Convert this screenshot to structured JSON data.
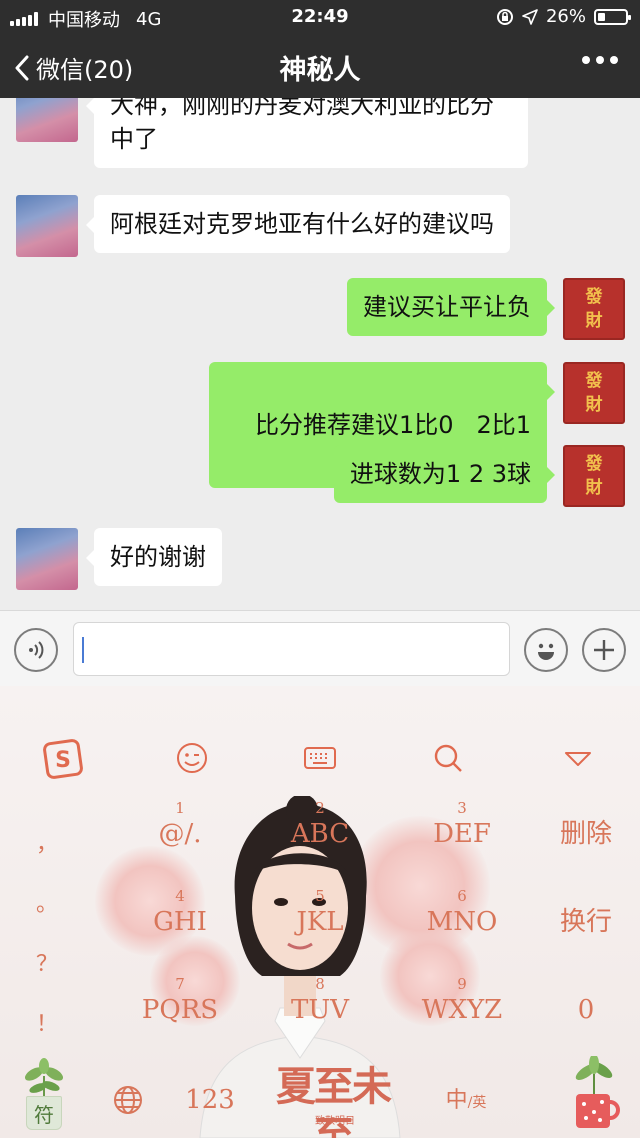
{
  "status_bar": {
    "carrier": "中国移动",
    "network": "4G",
    "time": "22:49",
    "battery": "26%",
    "battery_level": 0.26
  },
  "nav": {
    "back_label": "微信(20)",
    "title": "神秘人"
  },
  "messages": [
    {
      "side": "in",
      "text_line1": "大神，刚刚的丹麦对澳大利亚的比分",
      "text_line2": "中了"
    },
    {
      "side": "in",
      "text": "阿根廷对克罗地亚有什么好的建议吗"
    },
    {
      "side": "out",
      "text": "建议买让平让负"
    },
    {
      "side": "out",
      "text": "比分推荐建议1比0   2比1"
    },
    {
      "side": "out",
      "text": "进球数为1 2 3球"
    },
    {
      "side": "in",
      "text": "好的谢谢"
    }
  ],
  "self_avatar": {
    "top": "發",
    "bottom": "財"
  },
  "input": {
    "placeholder": ""
  },
  "keyboard": {
    "keys": [
      {
        "num": "1",
        "label": "@/."
      },
      {
        "num": "2",
        "label": "ABC"
      },
      {
        "num": "3",
        "label": "DEF"
      },
      {
        "num": "4",
        "label": "GHI"
      },
      {
        "num": "5",
        "label": "JKL"
      },
      {
        "num": "6",
        "label": "MNO"
      },
      {
        "num": "7",
        "label": "PQRS"
      },
      {
        "num": "8",
        "label": "TUV"
      },
      {
        "num": "9",
        "label": "WXYZ"
      }
    ],
    "delete_label": "删除",
    "newline_label": "换行",
    "zero_label": "0",
    "punct": [
      "，",
      "。",
      "？",
      "！"
    ],
    "symbol_label": "符",
    "num_label": "123",
    "lang_main": "中",
    "lang_alt": "/英",
    "brand_text": "夏至未至",
    "brand_sub": "致敬明日"
  },
  "colors": {
    "nav_bg": "#2e2e2e",
    "bubble_out": "#95ec69",
    "bubble_in": "#ffffff",
    "keyboard_accent": "#d8765a"
  },
  "icons": [
    "signal-icon",
    "location-arrow-icon",
    "orientation-lock-icon",
    "battery-icon",
    "back-chevron-icon",
    "more-icon",
    "voice-icon",
    "emoji-icon",
    "plus-icon",
    "sogou-logo-icon",
    "keyboard-emoji-icon",
    "keyboard-toggle-icon",
    "search-icon",
    "collapse-icon",
    "globe-icon",
    "plant-icon",
    "mug-icon"
  ]
}
